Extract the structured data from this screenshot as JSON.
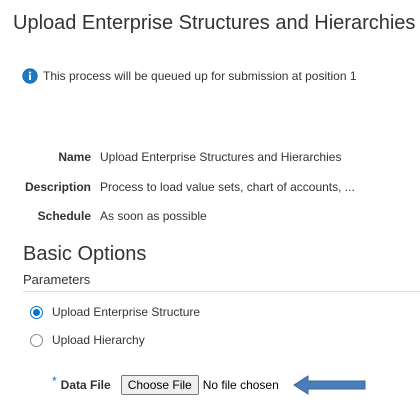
{
  "header": {
    "title": "Upload Enterprise Structures and Hierarchies"
  },
  "info": {
    "icon": "info-icon",
    "message": "This process will be queued up for submission at position 1"
  },
  "details": {
    "name_label": "Name",
    "name_value": "Upload Enterprise Structures and Hierarchies",
    "description_label": "Description",
    "description_value": "Process to load value sets, chart of accounts, ...",
    "schedule_label": "Schedule",
    "schedule_value": "As soon as possible"
  },
  "basic_options": {
    "title": "Basic Options",
    "parameters_label": "Parameters",
    "radio_options": [
      {
        "label": "Upload Enterprise Structure",
        "selected": true
      },
      {
        "label": "Upload Hierarchy",
        "selected": false
      }
    ],
    "data_file": {
      "required_marker": "*",
      "label": "Data File",
      "button_label": "Choose File",
      "status": "No file chosen"
    }
  },
  "colors": {
    "accent": "#0572ce",
    "arrow": "#4a7ebb",
    "info_icon": "#1f7ac4"
  }
}
